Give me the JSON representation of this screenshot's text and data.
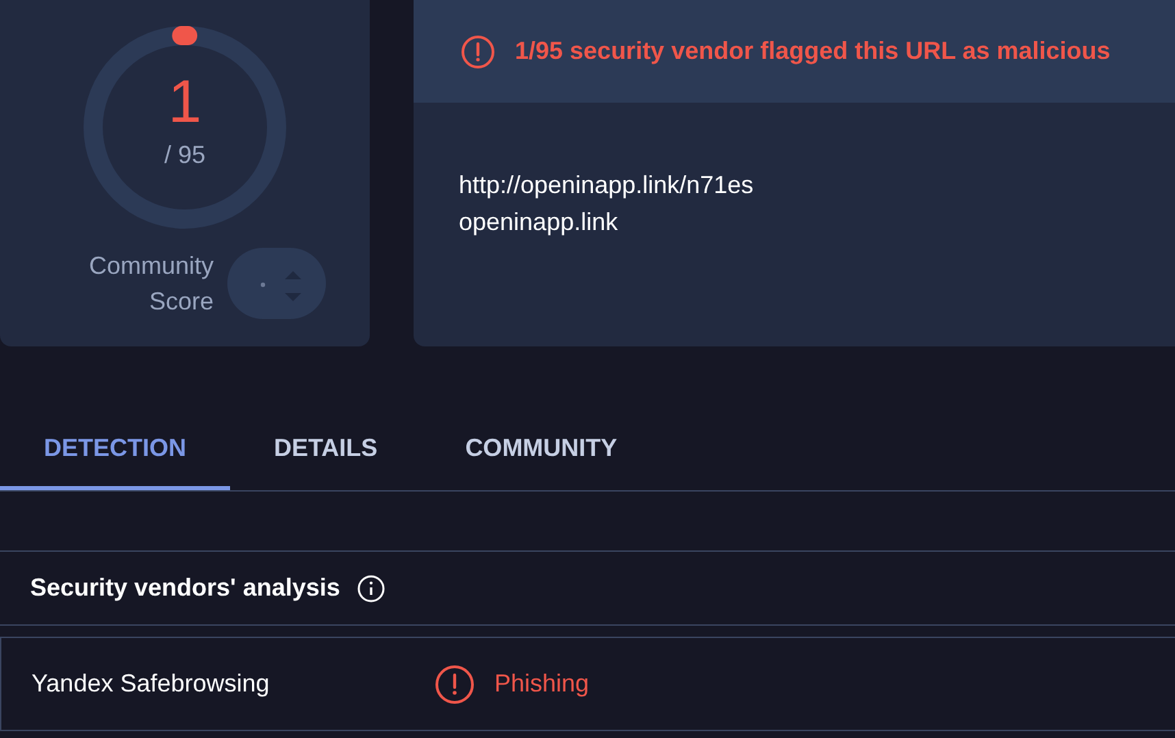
{
  "score_card": {
    "score": "1",
    "total": "/ 95",
    "level": 0.0105,
    "label_line_1": "Community",
    "label_line_2": "Score"
  },
  "summary": {
    "alert": "1/95 security vendor flagged this URL as malicious",
    "url": "http://openinapp.link/n71es",
    "domain": "openinapp.link"
  },
  "tabs": [
    {
      "label": "DETECTION",
      "selected": true
    },
    {
      "label": "DETAILS",
      "selected": false
    },
    {
      "label": "COMMUNITY",
      "selected": false
    }
  ],
  "section": {
    "title": "Security vendors' analysis"
  },
  "rows": [
    {
      "vendor": "Yandex Safebrowsing",
      "result": "Phishing",
      "kind": "malicious"
    }
  ]
}
